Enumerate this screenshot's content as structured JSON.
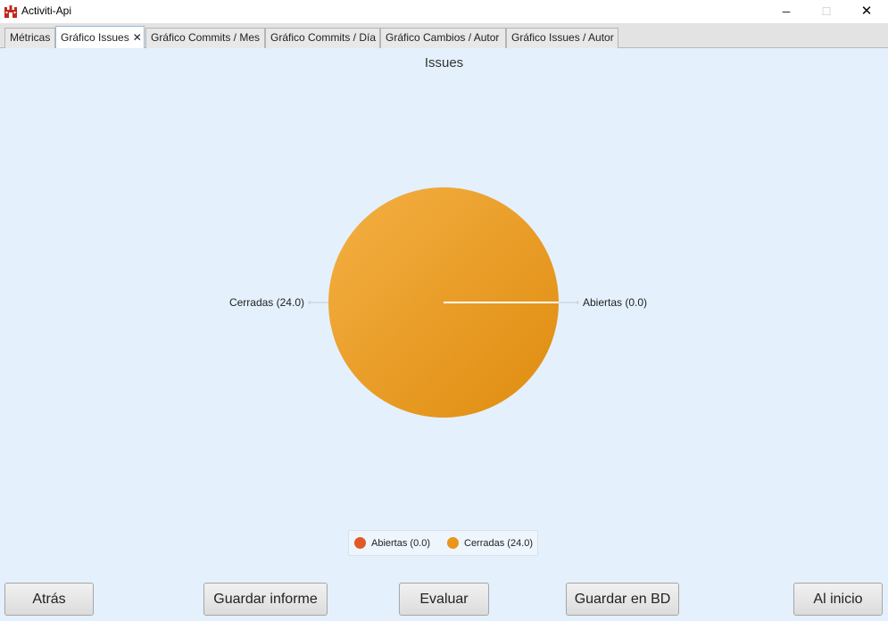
{
  "window": {
    "title": "Activiti-Api",
    "minimize": "─",
    "maximize": "☐",
    "close": "✕"
  },
  "tabs": [
    {
      "label": "Métricas"
    },
    {
      "label": "Gráfico Issues",
      "close": "✕"
    },
    {
      "label": "Gráfico Commits / Mes"
    },
    {
      "label": "Gráfico Commits / Día"
    },
    {
      "label": "Gráfico Cambios / Autor"
    },
    {
      "label": "Gráfico Issues / Autor"
    }
  ],
  "chart_data": {
    "type": "pie",
    "title": "Issues",
    "slices": [
      {
        "label": "Abiertas (0.0)",
        "value": 0.0,
        "color": "#e05a26"
      },
      {
        "label": "Cerradas (24.0)",
        "value": 24.0,
        "color": "#e8961c"
      }
    ],
    "legend_position": "bottom"
  },
  "legend": [
    {
      "label": "Abiertas (0.0)",
      "color": "#e05a26"
    },
    {
      "label": "Cerradas (24.0)",
      "color": "#e8961c"
    }
  ],
  "buttons": {
    "back": "Atrás",
    "save_report": "Guardar informe",
    "evaluate": "Evaluar",
    "save_db": "Guardar en BD",
    "home": "Al inicio"
  }
}
